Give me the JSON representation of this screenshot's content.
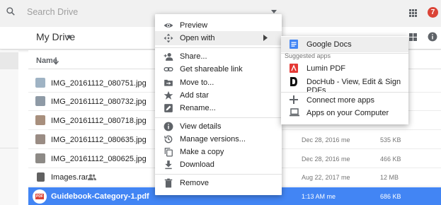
{
  "search": {
    "placeholder": "Search Drive"
  },
  "header": {
    "notification_count": "7",
    "breadcrumb": "My Drive"
  },
  "list": {
    "name_header": "Name",
    "files": [
      {
        "name": "IMG_20161112_080751.jpg",
        "modified": "",
        "size": "",
        "thumb": "#9fb3c4",
        "selected": false
      },
      {
        "name": "IMG_20161112_080732.jpg",
        "modified": "",
        "size": "",
        "thumb": "#8e9aa6",
        "selected": false
      },
      {
        "name": "IMG_20161112_080718.jpg",
        "modified": "",
        "size": "",
        "thumb": "#a88f7d",
        "selected": false
      },
      {
        "name": "IMG_20161112_080635.jpg",
        "modified": "Dec 28, 2016 me",
        "size": "535 KB",
        "thumb": "#9a8c84",
        "selected": false
      },
      {
        "name": "IMG_20161112_080625.jpg",
        "modified": "Dec 28, 2016 me",
        "size": "466 KB",
        "thumb": "#8d8a86",
        "selected": false
      },
      {
        "name": "Images.rar",
        "modified": "Aug 22, 2017 me",
        "size": "12 MB",
        "thumb": "#616161",
        "selected": false,
        "shared": true
      },
      {
        "name": "Guidebook-Category-1.pdf",
        "modified": "1:13 AM me",
        "size": "686 KB",
        "thumb": "#db4437",
        "selected": true
      }
    ]
  },
  "context_menu": {
    "items": [
      {
        "label": "Preview",
        "icon": "eye-icon"
      },
      {
        "label": "Open with",
        "icon": "move-arrows-icon",
        "submenu": true
      },
      {
        "label": "Share...",
        "icon": "person-add-icon"
      },
      {
        "label": "Get shareable link",
        "icon": "link-icon"
      },
      {
        "label": "Move to...",
        "icon": "folder-move-icon"
      },
      {
        "label": "Add star",
        "icon": "star-icon"
      },
      {
        "label": "Rename...",
        "icon": "pencil-icon"
      },
      {
        "label": "View details",
        "icon": "info-icon"
      },
      {
        "label": "Manage versions...",
        "icon": "history-icon"
      },
      {
        "label": "Make a copy",
        "icon": "copy-icon"
      },
      {
        "label": "Download",
        "icon": "download-icon"
      },
      {
        "label": "Remove",
        "icon": "trash-icon"
      }
    ]
  },
  "open_with_menu": {
    "primary_app": "Google Docs",
    "suggested_heading": "Suggested apps",
    "suggested": [
      "Lumin PDF",
      "DocHub - View, Edit & Sign PDFs"
    ],
    "more": [
      "Connect more apps",
      "Apps on your Computer"
    ]
  },
  "pdf_badge": "PDF",
  "colors": {
    "accent": "#4285f4",
    "notification": "#db4437",
    "docs_blue": "#4285f4"
  }
}
